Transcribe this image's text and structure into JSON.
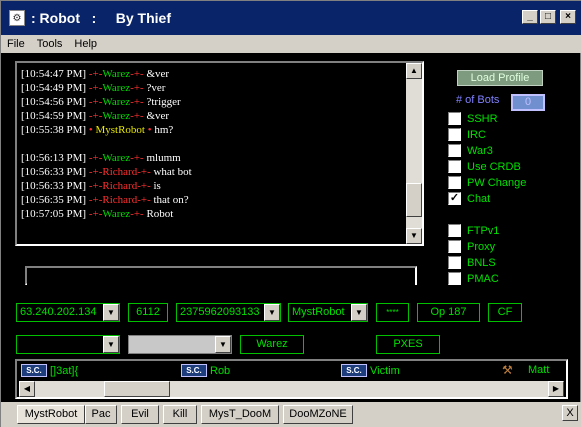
{
  "window": {
    "title": ": Robot   :     By Thief",
    "icon": "app-icon",
    "controls": {
      "minimize": "_",
      "maximize": "□",
      "close": "×"
    }
  },
  "menu": [
    "File",
    "Tools",
    "Help"
  ],
  "chat": {
    "lines": [
      {
        "ts": "[10:54:47 PM]",
        "pre": " -+-",
        "nick": "Warez",
        "post": "-+- ",
        "msg": "&ver",
        "color": "green"
      },
      {
        "ts": "[10:54:49 PM]",
        "pre": " -+-",
        "nick": "Warez",
        "post": "-+- ",
        "msg": "?ver",
        "color": "green"
      },
      {
        "ts": "[10:54:56 PM]",
        "pre": " -+-",
        "nick": "Warez",
        "post": "-+- ",
        "msg": "?trigger",
        "color": "green"
      },
      {
        "ts": "[10:54:59 PM]",
        "pre": " -+-",
        "nick": "Warez",
        "post": "-+- ",
        "msg": "&ver",
        "color": "green"
      },
      {
        "ts": "[10:55:38 PM]",
        "pre": " • ",
        "nick": "MystRobot",
        "post": " • ",
        "msg": "hm?",
        "color": "yellow"
      },
      {
        "ts": "",
        "pre": "",
        "nick": "",
        "post": "",
        "msg": "",
        "color": "green"
      },
      {
        "ts": "[10:56:13 PM]",
        "pre": " -+-",
        "nick": "Warez",
        "post": "-+- ",
        "msg": "mlumm",
        "color": "green"
      },
      {
        "ts": "[10:56:33 PM]",
        "pre": " -+-",
        "nick": "Richard",
        "post": "-+- ",
        "msg": "what bot",
        "color": "green"
      },
      {
        "ts": "[10:56:33 PM]",
        "pre": " -+-",
        "nick": "Richard",
        "post": "-+- ",
        "msg": "is",
        "color": "green"
      },
      {
        "ts": "[10:56:35 PM]",
        "pre": " -+-",
        "nick": "Richard",
        "post": "-+- ",
        "msg": "that on?",
        "color": "green"
      },
      {
        "ts": "[10:57:05 PM]",
        "pre": " -+-",
        "nick": "Warez",
        "post": "-+- ",
        "msg": "Robot",
        "color": "green"
      }
    ]
  },
  "panel": {
    "load_profile": "Load Profile",
    "bots_label": "# of Bots",
    "bots_count": "0",
    "options": [
      {
        "label": "SSHR",
        "checked": false
      },
      {
        "label": "IRC",
        "checked": false
      },
      {
        "label": "War3",
        "checked": false
      },
      {
        "label": "Use CRDB",
        "checked": false
      },
      {
        "label": "PW Change",
        "checked": false
      },
      {
        "label": "Chat",
        "checked": true
      },
      {
        "label": "FTPv1",
        "checked": false
      },
      {
        "label": "Proxy",
        "checked": false
      },
      {
        "label": "BNLS",
        "checked": false
      },
      {
        "label": "PMAC",
        "checked": false
      }
    ]
  },
  "input": {
    "value": "",
    "placeholder": ""
  },
  "server_row": {
    "server": "63.240.202.134",
    "port": "6112",
    "cdkey": "2375962093133",
    "account": "MystRobot",
    "password": "****",
    "op": "Op 187",
    "cf": "CF"
  },
  "row2": {
    "combo1": "",
    "combo2": "",
    "warez": "Warez",
    "pxes": "PXES"
  },
  "channel_users": [
    {
      "name": "[]3at]{",
      "badge": "S.C."
    },
    {
      "name": "Rob",
      "badge": "S.C."
    },
    {
      "name": "Victim",
      "badge": "S.C."
    },
    {
      "name": "Matt",
      "badge": "gavel"
    }
  ],
  "tabs": [
    "MystRobot",
    "Pac",
    "Evil",
    "Kill",
    "MysT_DooM",
    "DooMZoNE"
  ],
  "tab_close": "X"
}
